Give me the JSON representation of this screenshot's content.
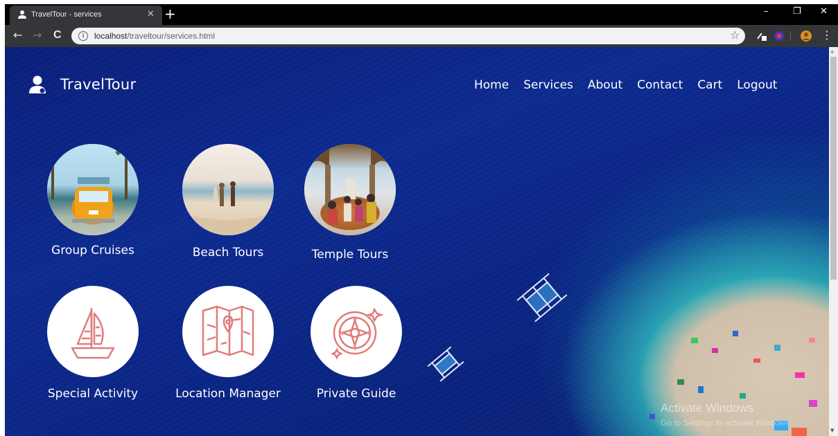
{
  "browser": {
    "tab_title": "TravelTour - services",
    "tab_close": "✕",
    "new_tab": "+",
    "url_host": "localhost",
    "url_path": "/traveltour/services.html",
    "window_controls": {
      "minimize": "–",
      "restore": "❐",
      "close": "✕"
    },
    "back": "←",
    "forward": "→",
    "reload": "C",
    "info": "i",
    "star": "☆",
    "menu": "⋮"
  },
  "site": {
    "brand": "TravelTour",
    "nav": [
      "Home",
      "Services",
      "About",
      "Contact",
      "Cart",
      "Logout"
    ]
  },
  "services": [
    {
      "label": "Group Cruises",
      "visual": "photo",
      "icon": "van-photo"
    },
    {
      "label": "Beach Tours",
      "visual": "photo",
      "icon": "beach-photo"
    },
    {
      "label": "Temple Tours",
      "visual": "photo",
      "icon": "temple-photo"
    },
    {
      "label": "Special Activity",
      "visual": "icon",
      "icon": "sailboat-icon"
    },
    {
      "label": "Location Manager",
      "visual": "icon",
      "icon": "map-icon"
    },
    {
      "label": "Private Guide",
      "visual": "icon",
      "icon": "compass-icon"
    }
  ],
  "os_watermark": {
    "line1": "Activate Windows",
    "line2": "Go to Settings to activate Windows."
  },
  "colors": {
    "icon_stroke": "#e07b7b",
    "sea": "#0d2a8f",
    "chrome_dark": "#35363a"
  }
}
